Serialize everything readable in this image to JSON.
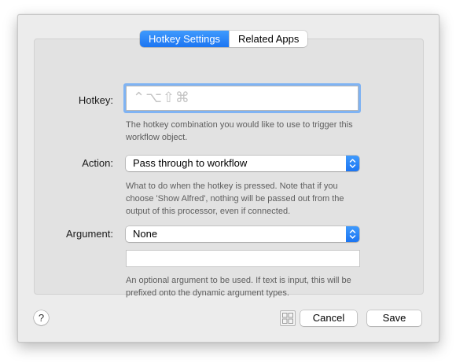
{
  "tabs": [
    {
      "label": "Hotkey Settings",
      "active": true
    },
    {
      "label": "Related Apps",
      "active": false
    }
  ],
  "hotkey": {
    "label": "Hotkey:",
    "value": "",
    "placeholder_glyphs": "⌃⌥⇧⌘",
    "help": "The hotkey combination you would like to use to trigger this workflow object."
  },
  "action": {
    "label": "Action:",
    "selected": "Pass through to workflow",
    "help": "What to do when the hotkey is pressed. Note that if you choose 'Show Alfred', nothing will be passed out from the output of this processor, even if connected."
  },
  "argument": {
    "label": "Argument:",
    "selected": "None",
    "text_value": "",
    "help": "An optional argument to be used. If text is input, this will be prefixed onto the dynamic argument types."
  },
  "footer": {
    "help_label": "?",
    "cancel_label": "Cancel",
    "save_label": "Save"
  },
  "colors": {
    "accent": "#1c75f2",
    "focus_ring": "#7fb3f3",
    "panel": "#ececec",
    "group": "#e2e2e2"
  },
  "icons": {
    "stepper": "up-down-chevron-icon",
    "grid": "grid-icon",
    "help": "question-mark-icon"
  }
}
